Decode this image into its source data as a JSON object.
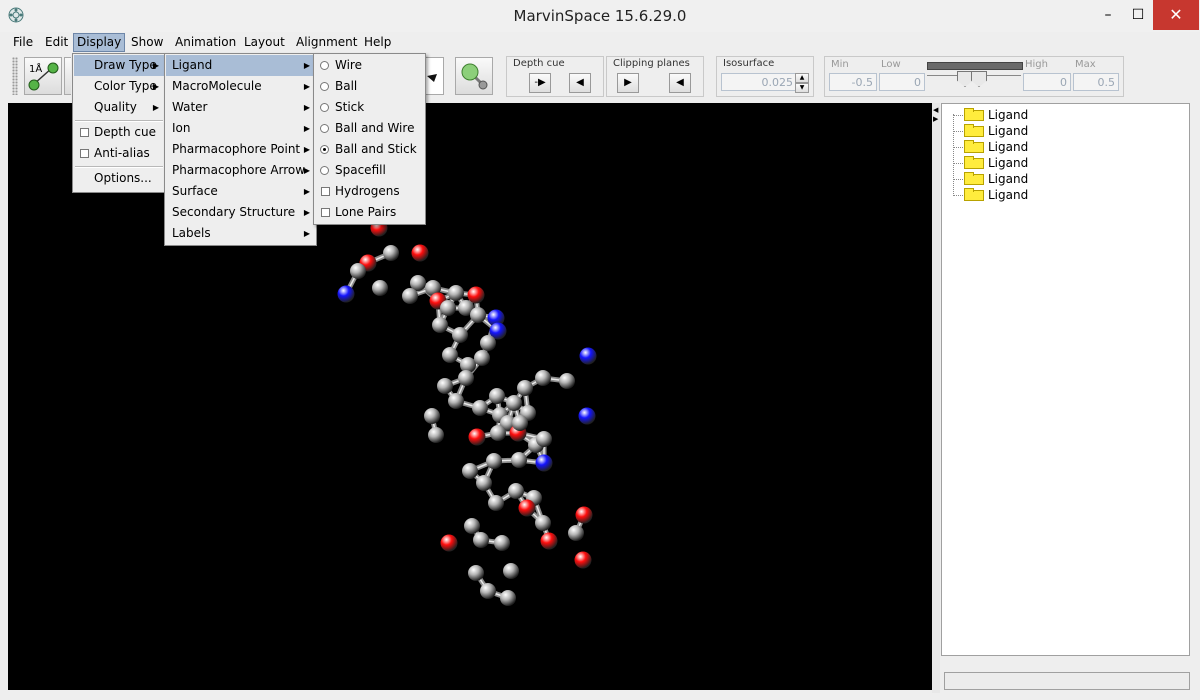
{
  "window": {
    "title": "MarvinSpace 15.6.29.0",
    "min": "–",
    "max": "☐",
    "close": "✕"
  },
  "menubar": [
    "File",
    "Edit",
    "Display",
    "Show",
    "Animation",
    "Layout",
    "Alignment",
    "Help"
  ],
  "toolbar": {
    "measure_label": "1Å",
    "depth_cue": {
      "label": "Depth cue",
      "minus": "-"
    },
    "clipping_planes": {
      "label": "Clipping planes"
    },
    "isosurface": {
      "label": "Isosurface",
      "value": "0.025"
    },
    "range": {
      "min_label": "Min",
      "low_label": "Low",
      "high_label": "High",
      "max_label": "Max",
      "min": "-0.5",
      "low": "0",
      "high": "0",
      "max": "0.5"
    }
  },
  "display_menu": {
    "draw_type": "Draw Type",
    "color_type": "Color Type",
    "quality": "Quality",
    "depth_cue": "Depth cue",
    "anti_alias": "Anti-alias",
    "options": "Options..."
  },
  "draw_type_menu": [
    "Ligand",
    "MacroMolecule",
    "Water",
    "Ion",
    "Pharmacophore Point",
    "Pharmacophore Arrow",
    "Surface",
    "Secondary Structure",
    "Labels"
  ],
  "ligand_menu": {
    "wire": "Wire",
    "ball": "Ball",
    "stick": "Stick",
    "ball_and_wire": "Ball and Wire",
    "ball_and_stick": "Ball and Stick",
    "spacefill": "Spacefill",
    "hydrogens": "Hydrogens",
    "lone_pairs": "Lone Pairs",
    "selected": "Ball and Stick"
  },
  "tree": [
    "Ligand",
    "Ligand",
    "Ligand",
    "Ligand",
    "Ligand",
    "Ligand"
  ],
  "colors": {
    "carbon": "#b4b4b4",
    "oxygen": "#ff0d0d",
    "nitrogen": "#1414ff",
    "background": "#000000",
    "menu_highlight": "#a9bdd6"
  }
}
